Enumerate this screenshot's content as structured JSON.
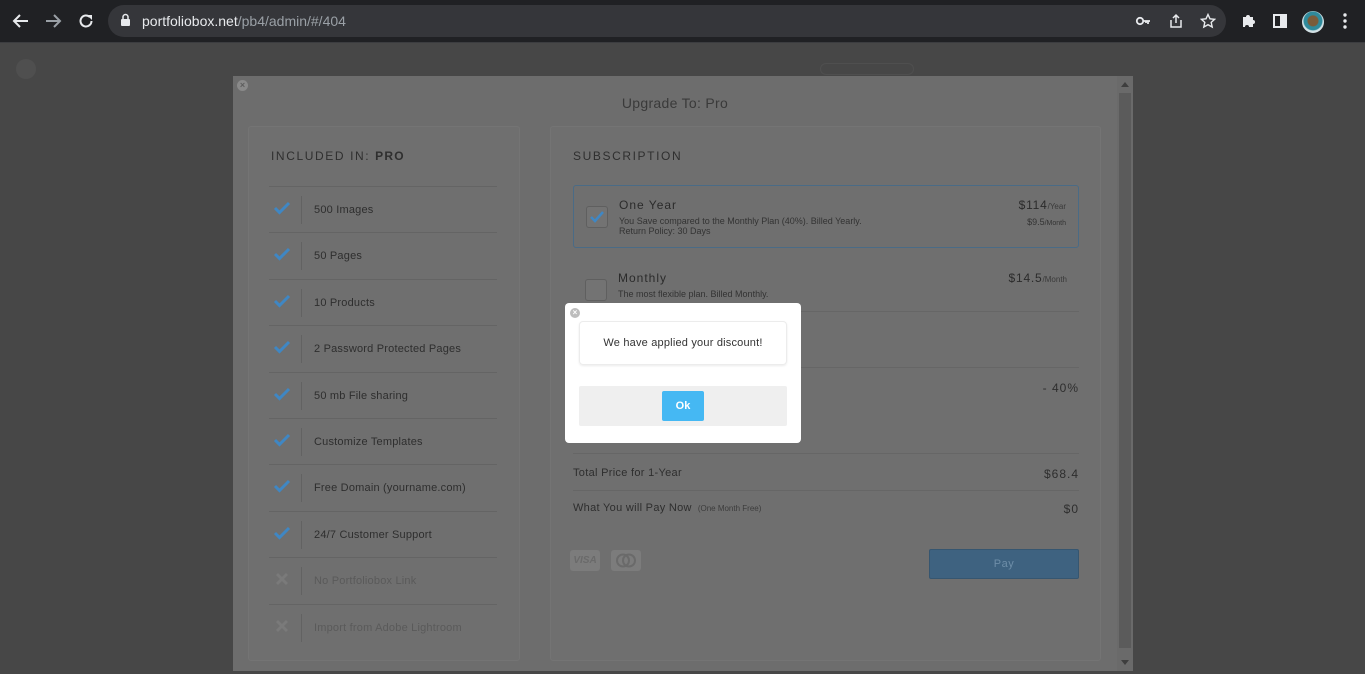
{
  "browser": {
    "url_host": "portfoliobox.net",
    "url_path": "/pb4/admin/#/404",
    "icons": [
      "back-icon",
      "forward-icon",
      "reload-icon",
      "lock-icon",
      "key-icon",
      "share-icon",
      "star-icon",
      "extensions-icon",
      "sidepanel-icon",
      "profile-avatar",
      "menu-icon"
    ]
  },
  "modal": {
    "title": "Upgrade To: Pro",
    "close_symbol": "×",
    "included": {
      "heading": "INCLUDED IN: ",
      "heading_plan": "PRO",
      "features": [
        {
          "label": "500 Images",
          "included": true
        },
        {
          "label": "50 Pages",
          "included": true
        },
        {
          "label": "10 Products",
          "included": true
        },
        {
          "label": "2 Password Protected Pages",
          "included": true
        },
        {
          "label": "50 mb File sharing",
          "included": true
        },
        {
          "label": "Customize Templates",
          "included": true
        },
        {
          "label": "Free Domain (yourname.com)",
          "included": true
        },
        {
          "label": "24/7 Customer Support",
          "included": true
        },
        {
          "label": "No Portfoliobox Link",
          "included": false
        },
        {
          "label": "Import from Adobe Lightroom",
          "included": false
        }
      ]
    },
    "subscription": {
      "heading": "SUBSCRIPTION",
      "plans": [
        {
          "name": "One Year",
          "desc_line1": "You Save compared to the Monthly Plan (40%). Billed Yearly.",
          "desc_line2": "Return Policy: 30 Days",
          "price": "$114",
          "price_unit": "/Year",
          "price_secondary": "$9.5",
          "price_secondary_unit": "/Month",
          "selected": true
        },
        {
          "name": "Monthly",
          "desc_line1": "The most flexible plan. Billed Monthly.",
          "price": "$14.5",
          "price_unit": "/Month",
          "selected": false
        }
      ],
      "discount_value": "- 40%",
      "total_label": "Total Price for 1-Year",
      "total_value": "$68.4",
      "pay_now_label": "What You will Pay Now",
      "pay_now_note": "(One Month Free)",
      "pay_now_value": "$0",
      "card_visa": "VISA",
      "pay_button": "Pay"
    }
  },
  "popup": {
    "message": "We have applied your discount!",
    "ok_label": "Ok",
    "close_symbol": "×"
  },
  "colors": {
    "ok_button": "#45b8f3",
    "checkmark": "#3f87c4",
    "chrome_bg": "#202124"
  }
}
